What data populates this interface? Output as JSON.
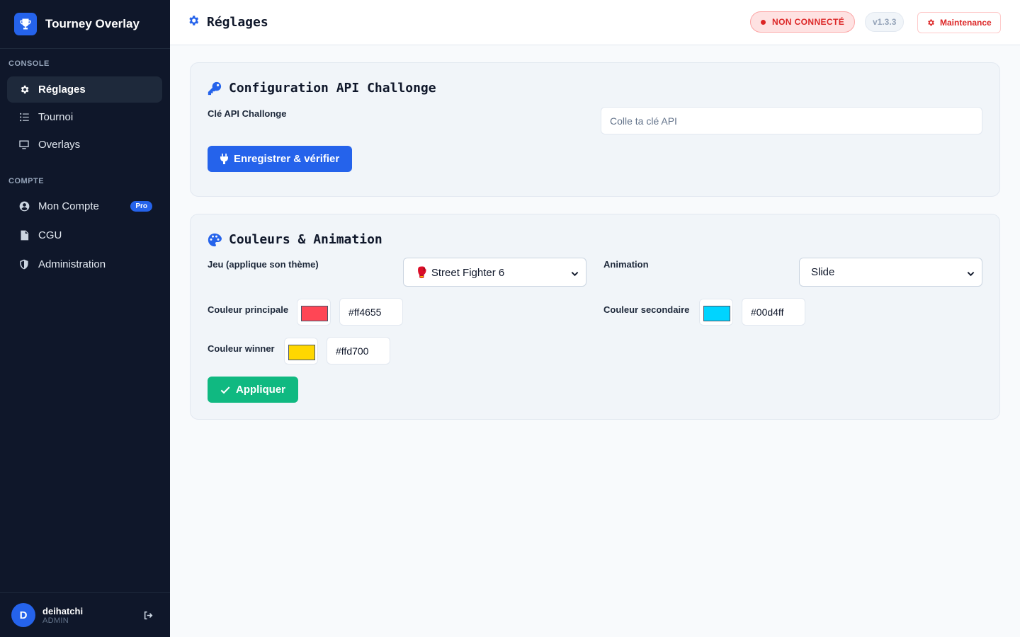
{
  "app": {
    "title": "Tourney Overlay"
  },
  "sidebar": {
    "sections": [
      {
        "label": "CONSOLE",
        "items": [
          {
            "label": "Réglages",
            "icon": "gear-icon",
            "active": true
          },
          {
            "label": "Tournoi",
            "icon": "list-ordered-icon"
          },
          {
            "label": "Overlays",
            "icon": "desktop-icon"
          }
        ]
      },
      {
        "label": "COMPTE",
        "items": [
          {
            "label": "Mon Compte",
            "icon": "user-circle-icon",
            "badge": "Pro"
          },
          {
            "label": "CGU",
            "icon": "document-icon"
          },
          {
            "label": "Administration",
            "icon": "shield-icon"
          }
        ]
      }
    ],
    "user": {
      "initial": "D",
      "name": "deihatchi",
      "role": "ADMIN"
    }
  },
  "header": {
    "title": "Réglages",
    "status": "NON CONNECTÉ",
    "version": "v1.3.3",
    "maintenance_label": "Maintenance"
  },
  "api_card": {
    "title": "Configuration API Challonge",
    "key_label": "Clé API Challonge",
    "key_placeholder": "Colle ta clé API",
    "key_value": "",
    "save_button": "Enregistrer & vérifier"
  },
  "colors_card": {
    "title": "Couleurs & Animation",
    "game_label": "Jeu (applique son thème)",
    "game_value": "🥊 Street Fighter 6",
    "animation_label": "Animation",
    "animation_value": "Slide",
    "primary_label": "Couleur principale",
    "primary_hex": "#ff4655",
    "secondary_label": "Couleur secondaire",
    "secondary_hex": "#00d4ff",
    "winner_label": "Couleur winner",
    "winner_hex": "#ffd700",
    "apply_button": "Appliquer"
  },
  "colors": {
    "accent": "#2563eb",
    "sidebar_bg": "#0f172a",
    "danger": "#dc2626",
    "success": "#10b981"
  }
}
